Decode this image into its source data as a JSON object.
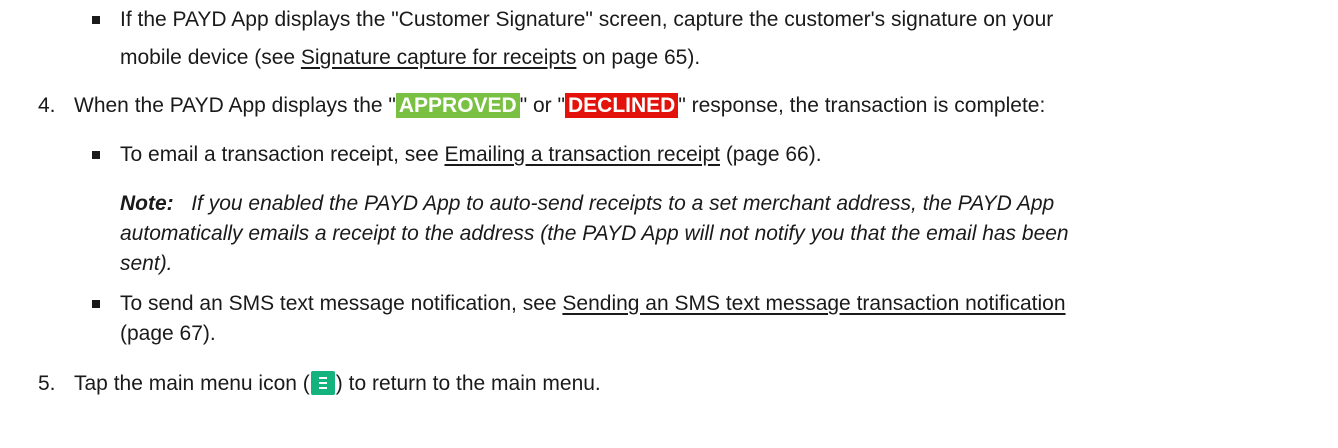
{
  "b1": {
    "line1": "If the PAYD App displays the \"Customer Signature\" screen, capture the customer's signature on your",
    "line2_pre": "mobile device (see ",
    "line2_link": "Signature capture for receipts",
    "line2_post": " on page 65)."
  },
  "s4": {
    "num": "4.",
    "pre": "When the PAYD App displays the \"",
    "approved": "APPROVED",
    "mid": "\" or \"",
    "declined": "DECLINED",
    "post": "\" response, the transaction is complete:"
  },
  "b2": {
    "pre": "To email a transaction receipt, see ",
    "link": "Emailing a transaction receipt",
    "post": " (page 66)."
  },
  "note": {
    "label": "Note:",
    "line1": "If you enabled the PAYD App to auto-send receipts to a set merchant address, the PAYD App",
    "line2": "automatically emails a receipt to the address (the PAYD App will not notify you that the email has been",
    "line3": "sent)."
  },
  "b3": {
    "pre": "To send an SMS text message notification, see ",
    "link": "Sending an SMS text message transaction notification",
    "line2": "(page 67)."
  },
  "s5": {
    "num": "5.",
    "pre": "Tap the main menu icon (",
    "post": ") to return to the main menu."
  },
  "colors": {
    "approved": "#7ac143",
    "declined": "#e3130b",
    "menu_icon": "#14b37d"
  },
  "icons": {
    "menu": "main-menu-icon"
  }
}
